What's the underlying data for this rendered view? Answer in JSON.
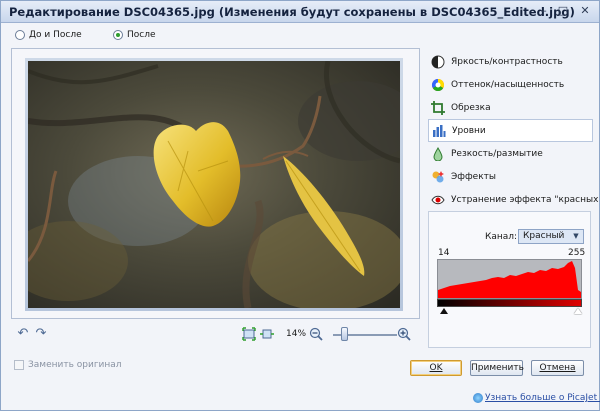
{
  "window": {
    "title": "Редактирование DSC04365.jpg (Изменения будут сохранены в DSC04365_Edited.jpg)",
    "minimize_glyph": "–",
    "maximize_glyph": "□",
    "close_glyph": "✕"
  },
  "view_mode": {
    "options": [
      {
        "label": "До и После",
        "selected": false
      },
      {
        "label": "После",
        "selected": true
      }
    ]
  },
  "toolbar": {
    "undo_icon": "undo-icon",
    "redo_icon": "redo-icon",
    "fit_icon": "fit-to-window-icon",
    "actual_size_icon": "actual-size-icon",
    "zoom_out_icon": "zoom-out-icon",
    "zoom_in_icon": "zoom-in-icon",
    "zoom_value": "14%",
    "zoom_level": 0.12
  },
  "menu": {
    "items": [
      {
        "label": "Яркость/контрастность",
        "icon": "brightness-contrast-icon",
        "active": false
      },
      {
        "label": "Оттенок/насыщенность",
        "icon": "hue-saturation-icon",
        "active": false
      },
      {
        "label": "Обрезка",
        "icon": "crop-icon",
        "active": false
      },
      {
        "label": "Уровни",
        "icon": "levels-icon",
        "active": true
      },
      {
        "label": "Резкость/размытие",
        "icon": "sharpen-blur-icon",
        "active": false
      },
      {
        "label": "Эффекты",
        "icon": "effects-icon",
        "active": false
      },
      {
        "label": "Устранение эффекта \"красных глаз\"",
        "icon": "red-eye-icon",
        "active": false
      }
    ]
  },
  "levels": {
    "channel_label": "Канал:",
    "channel_value": "Красный",
    "min_value": "14",
    "max_value": "255",
    "histogram_color": "#ff0000"
  },
  "bottom": {
    "replace_original_label": "Заменить оригинал",
    "replace_original_checked": false,
    "ok_label": "OK",
    "apply_label": "Применить",
    "cancel_label": "Отмена",
    "link_text": "Узнать больше о PicaJet FX"
  },
  "colors": {
    "accent": "#2f9e2f",
    "default_button_border": "#cf9a2f",
    "link": "#2b4fa5"
  }
}
